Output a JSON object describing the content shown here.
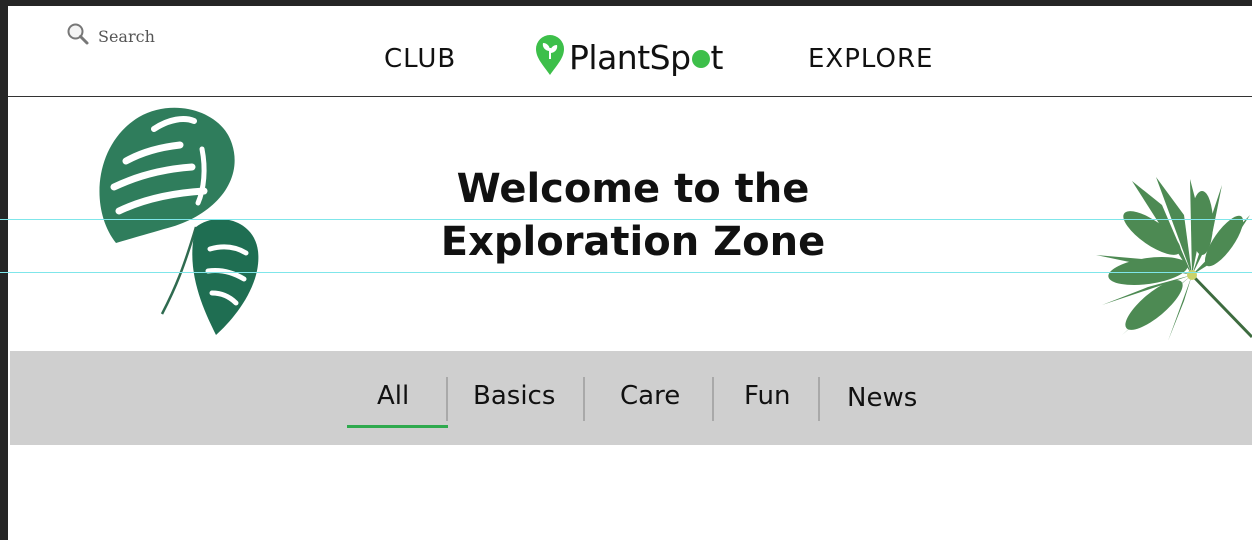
{
  "header": {
    "search_label": "Search",
    "nav_left": "CLUB",
    "nav_right": "EXPLORE",
    "logo": {
      "text_before": "PlantSp",
      "text_after": "t",
      "brand_color": "#3dbf4a"
    }
  },
  "hero": {
    "title_line1": "Welcome to the",
    "title_line2": "Exploration Zone"
  },
  "tabs": {
    "items": [
      {
        "label": "All",
        "active": true
      },
      {
        "label": "Basics"
      },
      {
        "label": "Care"
      },
      {
        "label": "Fun"
      },
      {
        "label": "News"
      }
    ],
    "active_color": "#2faa4e"
  }
}
